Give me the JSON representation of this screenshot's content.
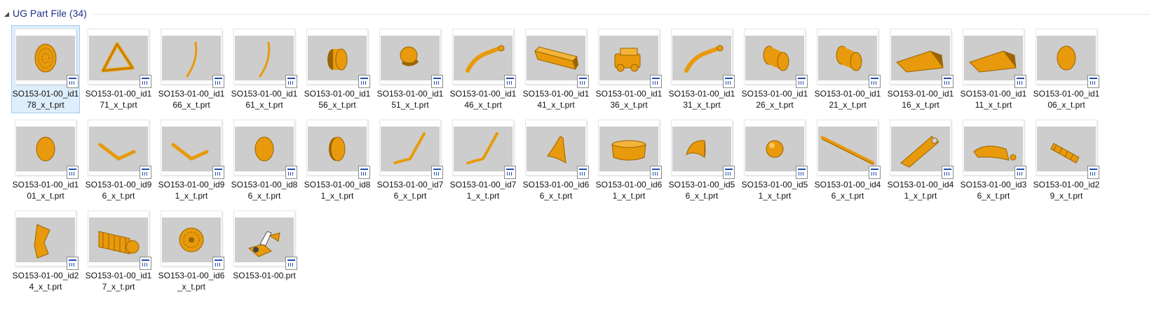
{
  "group": {
    "title": "UG Part File (34)"
  },
  "colors": {
    "part": "#e89a0c",
    "part_edge": "#9c6400",
    "thumb_bg": "#cdcdcd",
    "group_title": "#1e3287"
  },
  "files": [
    {
      "name": "SO153-01-00_id178_x_t.prt",
      "icon": "round-grille-disc",
      "selected": true
    },
    {
      "name": "SO153-01-00_id171_x_t.prt",
      "icon": "triangle-frame"
    },
    {
      "name": "SO153-01-00_id166_x_t.prt",
      "icon": "thin-arc-rod"
    },
    {
      "name": "SO153-01-00_id161_x_t.prt",
      "icon": "thin-arc-rod"
    },
    {
      "name": "SO153-01-00_id156_x_t.prt",
      "icon": "short-cylinder"
    },
    {
      "name": "SO153-01-00_id151_x_t.prt",
      "icon": "dome-knob"
    },
    {
      "name": "SO153-01-00_id146_x_t.prt",
      "icon": "curved-handle"
    },
    {
      "name": "SO153-01-00_id141_x_t.prt",
      "icon": "long-block"
    },
    {
      "name": "SO153-01-00_id136_x_t.prt",
      "icon": "hinge-block"
    },
    {
      "name": "SO153-01-00_id131_x_t.prt",
      "icon": "curved-handle"
    },
    {
      "name": "SO153-01-00_id126_x_t.prt",
      "icon": "cylinder"
    },
    {
      "name": "SO153-01-00_id121_x_t.prt",
      "icon": "cylinder"
    },
    {
      "name": "SO153-01-00_id116_x_t.prt",
      "icon": "wedge-plate"
    },
    {
      "name": "SO153-01-00_id111_x_t.prt",
      "icon": "wedge-plate"
    },
    {
      "name": "SO153-01-00_id106_x_t.prt",
      "icon": "oval-disc"
    },
    {
      "name": "SO153-01-00_id101_x_t.prt",
      "icon": "oval-disc"
    },
    {
      "name": "SO153-01-00_id96_x_t.prt",
      "icon": "v-bracket"
    },
    {
      "name": "SO153-01-00_id91_x_t.prt",
      "icon": "v-bracket"
    },
    {
      "name": "SO153-01-00_id86_x_t.prt",
      "icon": "oval-disc"
    },
    {
      "name": "SO153-01-00_id81_x_t.prt",
      "icon": "tilted-disc"
    },
    {
      "name": "SO153-01-00_id76_x_t.prt",
      "icon": "l-rod"
    },
    {
      "name": "SO153-01-00_id71_x_t.prt",
      "icon": "l-rod"
    },
    {
      "name": "SO153-01-00_id66_x_t.prt",
      "icon": "curved-fin"
    },
    {
      "name": "SO153-01-00_id61_x_t.prt",
      "icon": "flat-puck"
    },
    {
      "name": "SO153-01-00_id56_x_t.prt",
      "icon": "half-shell"
    },
    {
      "name": "SO153-01-00_id51_x_t.prt",
      "icon": "sphere"
    },
    {
      "name": "SO153-01-00_id46_x_t.prt",
      "icon": "long-rod"
    },
    {
      "name": "SO153-01-00_id41_x_t.prt",
      "icon": "lever-arm"
    },
    {
      "name": "SO153-01-00_id36_x_t.prt",
      "icon": "wing-clip"
    },
    {
      "name": "SO153-01-00_id29_x_t.prt",
      "icon": "slatted-piece"
    },
    {
      "name": "SO153-01-00_id24_x_t.prt",
      "icon": "bent-plate"
    },
    {
      "name": "SO153-01-00_id17_x_t.prt",
      "icon": "ribbed-roller"
    },
    {
      "name": "SO153-01-00_id6_x_t.prt",
      "icon": "gear-wheel"
    },
    {
      "name": "SO153-01-00.prt",
      "icon": "assembly"
    }
  ]
}
